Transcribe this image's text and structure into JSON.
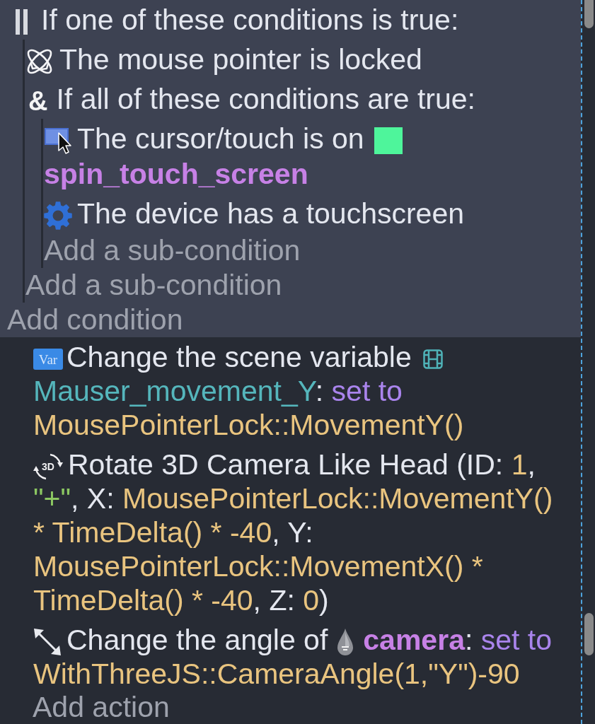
{
  "conditions": [
    {
      "kind": "or",
      "lines": [
        [
          {
            "kind": "text",
            "runs": [
              {
                "kind": "plain",
                "text": "If one of these conditions is true:"
              }
            ]
          }
        ]
      ],
      "children": [
        {
          "kind": "pointer_locked",
          "lines": [
            [
              {
                "kind": "text",
                "runs": [
                  {
                    "kind": "plain",
                    "text": "The mouse pointer is locked"
                  }
                ]
              }
            ]
          ]
        },
        {
          "kind": "and",
          "symbol": "&",
          "lines": [
            [
              {
                "kind": "text",
                "runs": [
                  {
                    "kind": "plain",
                    "text": "If all of these conditions are true:"
                  }
                ]
              }
            ]
          ],
          "children": [
            {
              "kind": "cursor_on_object",
              "lines": [
                [
                  {
                    "kind": "text",
                    "runs": [
                      {
                        "kind": "plain",
                        "text": "The cursor/touch is on"
                      }
                    ]
                  },
                  {
                    "kind": "object_thumbnail"
                  }
                ],
                [
                  {
                    "kind": "text",
                    "runs": [
                      {
                        "kind": "object",
                        "text": "spin_touch_screen"
                      }
                    ]
                  }
                ]
              ]
            },
            {
              "kind": "touchscreen",
              "lines": [
                [
                  {
                    "kind": "text",
                    "runs": [
                      {
                        "kind": "plain",
                        "text": "The device has a touchscreen"
                      }
                    ]
                  }
                ]
              ]
            }
          ],
          "add_label": "Add a sub-condition"
        }
      ],
      "add_label": "Add a sub-condition"
    }
  ],
  "add_condition": "Add condition",
  "actions": [
    {
      "kind": "scene_variable",
      "badge": "Var",
      "lines": [
        [
          {
            "kind": "text",
            "runs": [
              {
                "kind": "plain",
                "text": "Change the scene variable"
              }
            ]
          },
          {
            "kind": "scene_icon"
          }
        ],
        [
          {
            "kind": "text",
            "runs": [
              {
                "kind": "variable",
                "text": "Mauser_movement_Y"
              },
              {
                "kind": "plain",
                "text": ": "
              },
              {
                "kind": "operator",
                "text": "set to"
              }
            ]
          }
        ],
        [
          {
            "kind": "text",
            "runs": [
              {
                "kind": "value",
                "text": "MousePointerLock::MovementY()"
              }
            ]
          }
        ]
      ]
    },
    {
      "kind": "rotate_camera",
      "badge": "3D",
      "lines": [
        [
          {
            "kind": "text",
            "runs": [
              {
                "kind": "plain",
                "text": "Rotate 3D Camera Like Head (ID: "
              },
              {
                "kind": "value",
                "text": "1"
              },
              {
                "kind": "plain",
                "text": ","
              }
            ]
          }
        ],
        [
          {
            "kind": "text",
            "runs": [
              {
                "kind": "string",
                "text": "\"+\""
              },
              {
                "kind": "plain",
                "text": ", X: "
              },
              {
                "kind": "value",
                "text": "MousePointerLock::MovementY()"
              }
            ]
          }
        ],
        [
          {
            "kind": "text",
            "runs": [
              {
                "kind": "value",
                "text": "* TimeDelta() * -40"
              },
              {
                "kind": "plain",
                "text": ", Y:"
              }
            ]
          }
        ],
        [
          {
            "kind": "text",
            "runs": [
              {
                "kind": "value",
                "text": "MousePointerLock::MovementX() *"
              }
            ]
          }
        ],
        [
          {
            "kind": "text",
            "runs": [
              {
                "kind": "value",
                "text": "TimeDelta() * -40"
              },
              {
                "kind": "plain",
                "text": ", Z: "
              },
              {
                "kind": "value",
                "text": "0"
              },
              {
                "kind": "plain",
                "text": ")"
              }
            ]
          }
        ]
      ]
    },
    {
      "kind": "object_angle",
      "lines": [
        [
          {
            "kind": "text",
            "runs": [
              {
                "kind": "plain",
                "text": "Change the angle of"
              }
            ]
          },
          {
            "kind": "object_icon"
          },
          {
            "kind": "text",
            "runs": [
              {
                "kind": "object",
                "text": "camera"
              },
              {
                "kind": "plain",
                "text": ": "
              },
              {
                "kind": "operator",
                "text": "set to"
              }
            ]
          }
        ],
        [
          {
            "kind": "text",
            "runs": [
              {
                "kind": "value",
                "text": "WithThreeJS::CameraAngle(1,\"Y\")-90"
              }
            ]
          }
        ]
      ]
    }
  ],
  "add_action": "Add action"
}
